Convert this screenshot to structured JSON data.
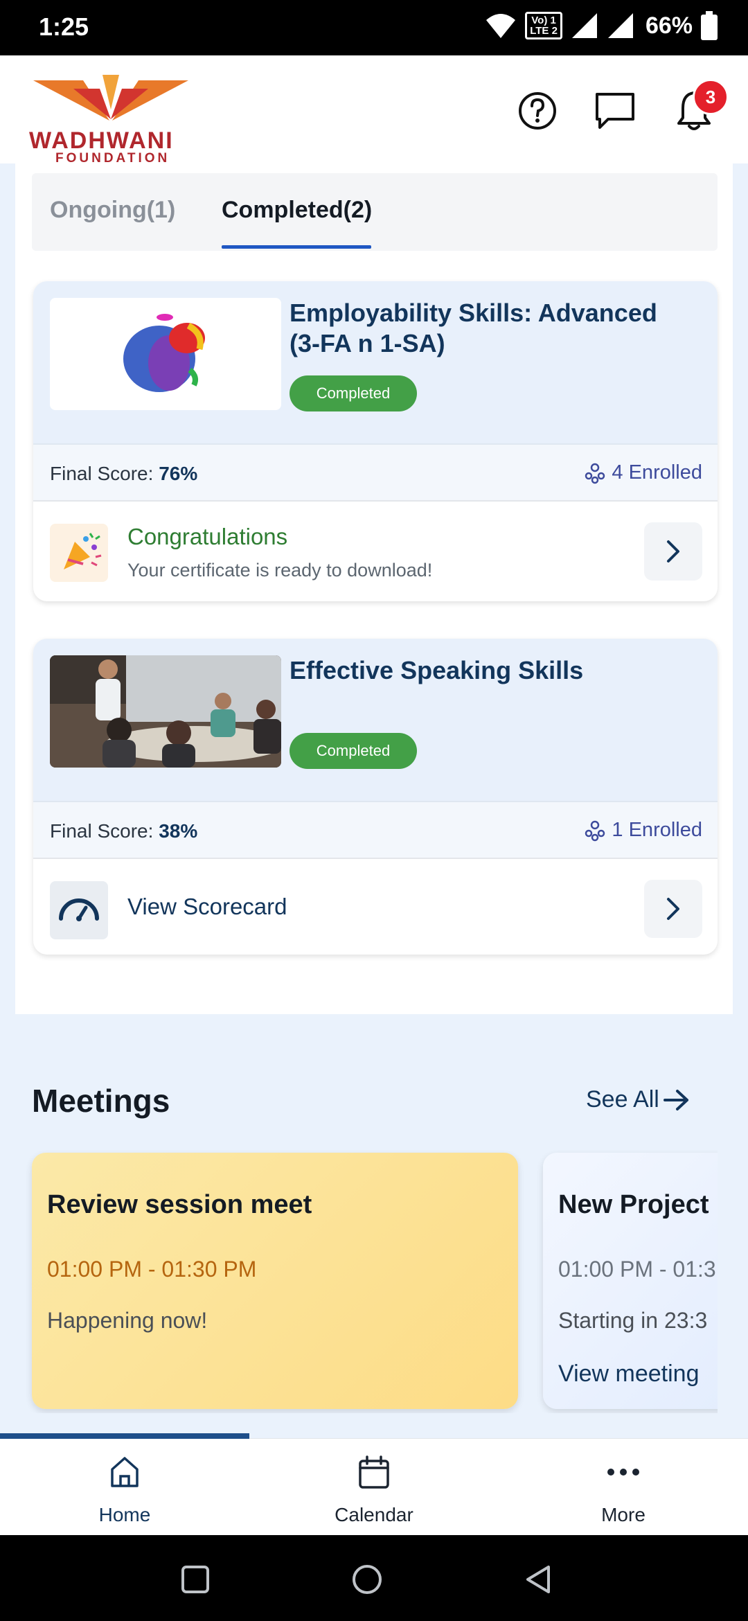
{
  "status_bar": {
    "time": "1:25",
    "battery": "66%",
    "network_line1": "Vo) 1",
    "network_line2": "LTE 2"
  },
  "header": {
    "logo_name": "WADHWANI",
    "logo_sub": "FOUNDATION",
    "notification_count": "3",
    "icons": [
      "help-icon",
      "chat-icon",
      "bell-icon"
    ]
  },
  "tabs": [
    {
      "label": "Ongoing(1)",
      "active": false
    },
    {
      "label": "Completed(2)",
      "active": true
    }
  ],
  "courses": [
    {
      "title": "Employability Skills: Advanced (3-FA n 1-SA)",
      "status": "Completed",
      "score_label": "Final Score:",
      "score_value": "76%",
      "enrolled": "4 Enrolled",
      "action_title": "Congratulations",
      "action_subtitle": "Your certificate is ready to download!",
      "action_icon": "party-popper-icon"
    },
    {
      "title": "Effective Speaking Skills",
      "status": "Completed",
      "score_label": "Final Score:",
      "score_value": "38%",
      "enrolled": "1 Enrolled",
      "action_title": "View Scorecard",
      "action_icon": "gauge-icon"
    }
  ],
  "meetings": {
    "title": "Meetings",
    "see_all": "See All",
    "items": [
      {
        "title": "Review session meet",
        "time": "01:00 PM - 01:30 PM",
        "status": "Happening now!"
      },
      {
        "title": "New Project",
        "time": "01:00 PM - 01:3",
        "status": "Starting in 23:3",
        "link": "View meeting"
      }
    ]
  },
  "bottom_nav": [
    {
      "label": "Home",
      "icon": "home-icon",
      "active": true
    },
    {
      "label": "Calendar",
      "icon": "calendar-icon",
      "active": false
    },
    {
      "label": "More",
      "icon": "more-dots-icon",
      "active": false
    }
  ],
  "colors": {
    "primary_navy": "#12355b",
    "completed_green": "#43a047",
    "congrats_green": "#2e7d32",
    "meeting_time_orange": "#b5650f",
    "badge_red": "#e4202b",
    "page_bg": "#eaf2fc"
  }
}
